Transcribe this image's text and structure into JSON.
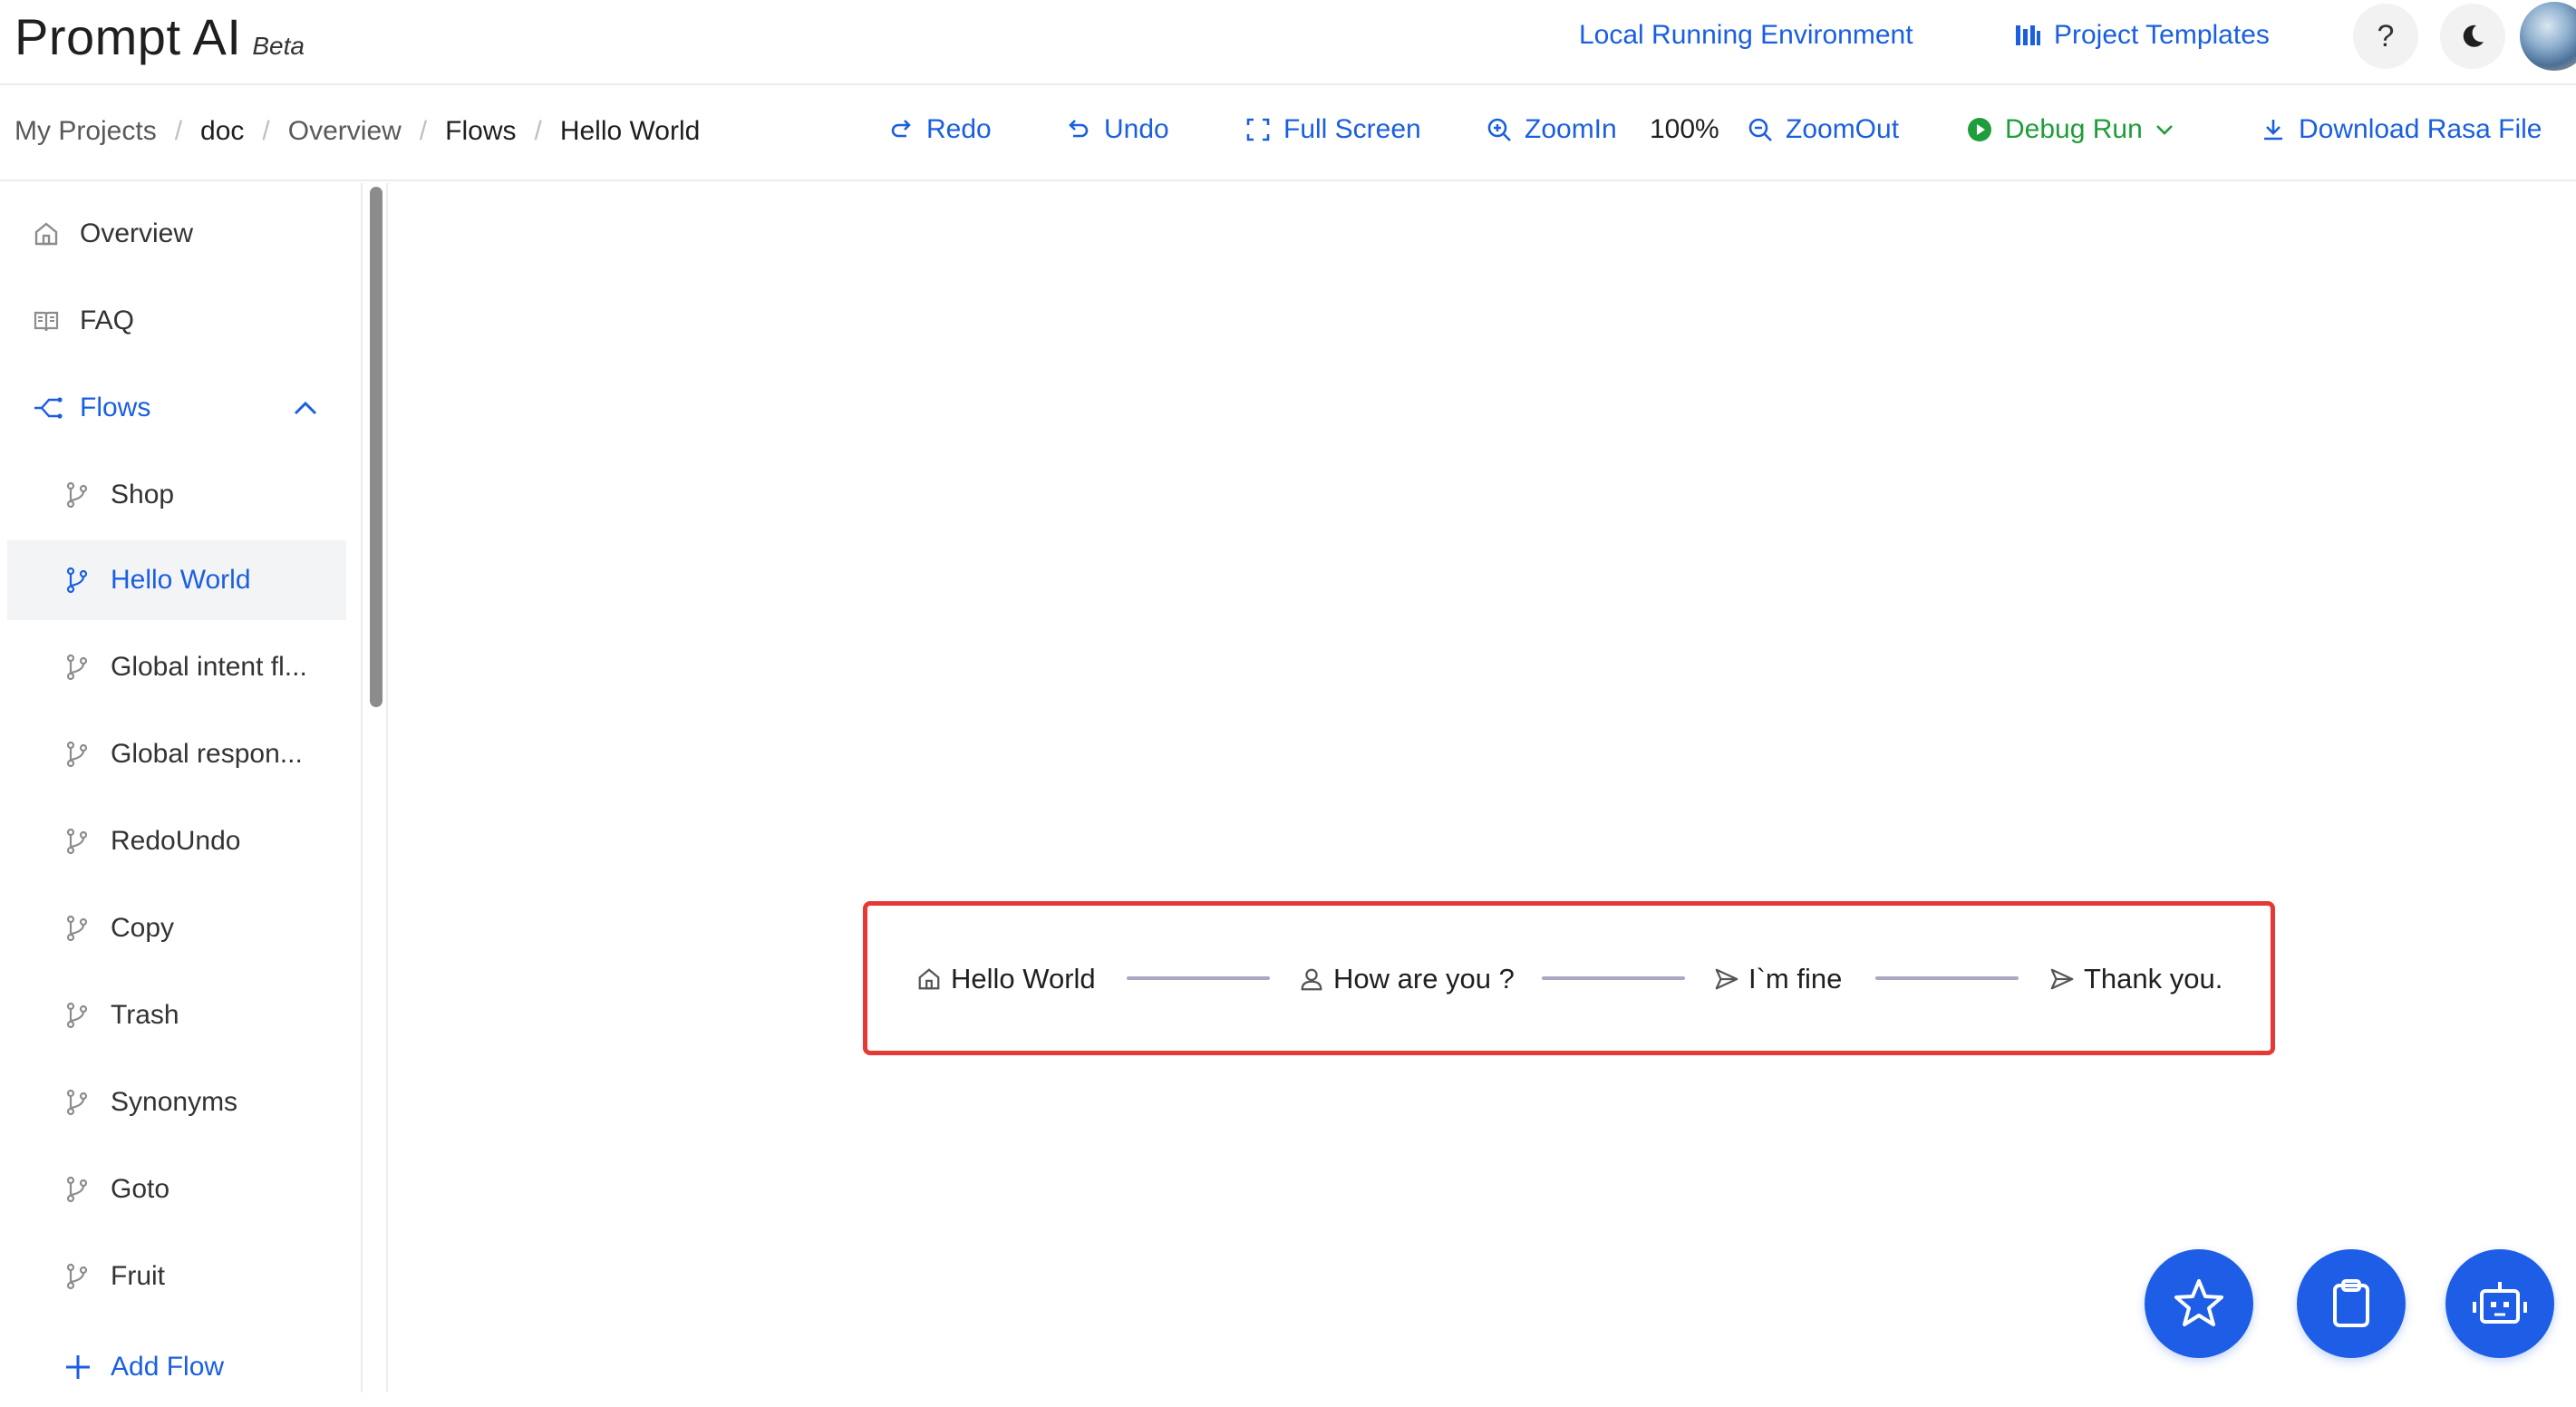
{
  "header": {
    "brand_name": "Prompt AI",
    "brand_tag": "Beta",
    "local_env_label": "Local Running Environment",
    "templates_label": "Project Templates",
    "help_glyph": "?",
    "help_icon": "question-icon",
    "theme_icon": "moon-icon",
    "accent_color": "#1a5fe0"
  },
  "breadcrumb": [
    "My Projects",
    "doc",
    "Overview",
    "Flows",
    "Hello World"
  ],
  "toolbar": {
    "redo": "Redo",
    "undo": "Undo",
    "full_screen": "Full Screen",
    "zoom_in": "ZoomIn",
    "zoom_value": "100%",
    "zoom_out": "ZoomOut",
    "debug_run": "Debug Run",
    "debug_color": "#1f9d3a",
    "download": "Download Rasa File"
  },
  "sidebar": {
    "items": [
      {
        "label": "Overview",
        "icon": "home-icon"
      },
      {
        "label": "FAQ",
        "icon": "book-icon"
      },
      {
        "label": "Flows",
        "icon": "flow-icon",
        "expanded": true
      }
    ],
    "flows": [
      "Shop",
      "Hello World",
      "Global intent fl...",
      "Global respon...",
      "RedoUndo",
      "Copy",
      "Trash",
      "Synonyms",
      "Goto",
      "Fruit"
    ],
    "active_flow": "Hello World",
    "add_flow": "Add Flow"
  },
  "flow": {
    "highlight_color": "#e53935",
    "nodes": [
      {
        "label": "Hello World",
        "icon": "home-icon"
      },
      {
        "label": "How are you ?",
        "icon": "user-icon"
      },
      {
        "label": "I`m fine",
        "icon": "send-icon"
      },
      {
        "label": "Thank you.",
        "icon": "send-icon"
      }
    ]
  },
  "fabs": [
    "star-icon",
    "clipboard-icon",
    "robot-icon"
  ]
}
